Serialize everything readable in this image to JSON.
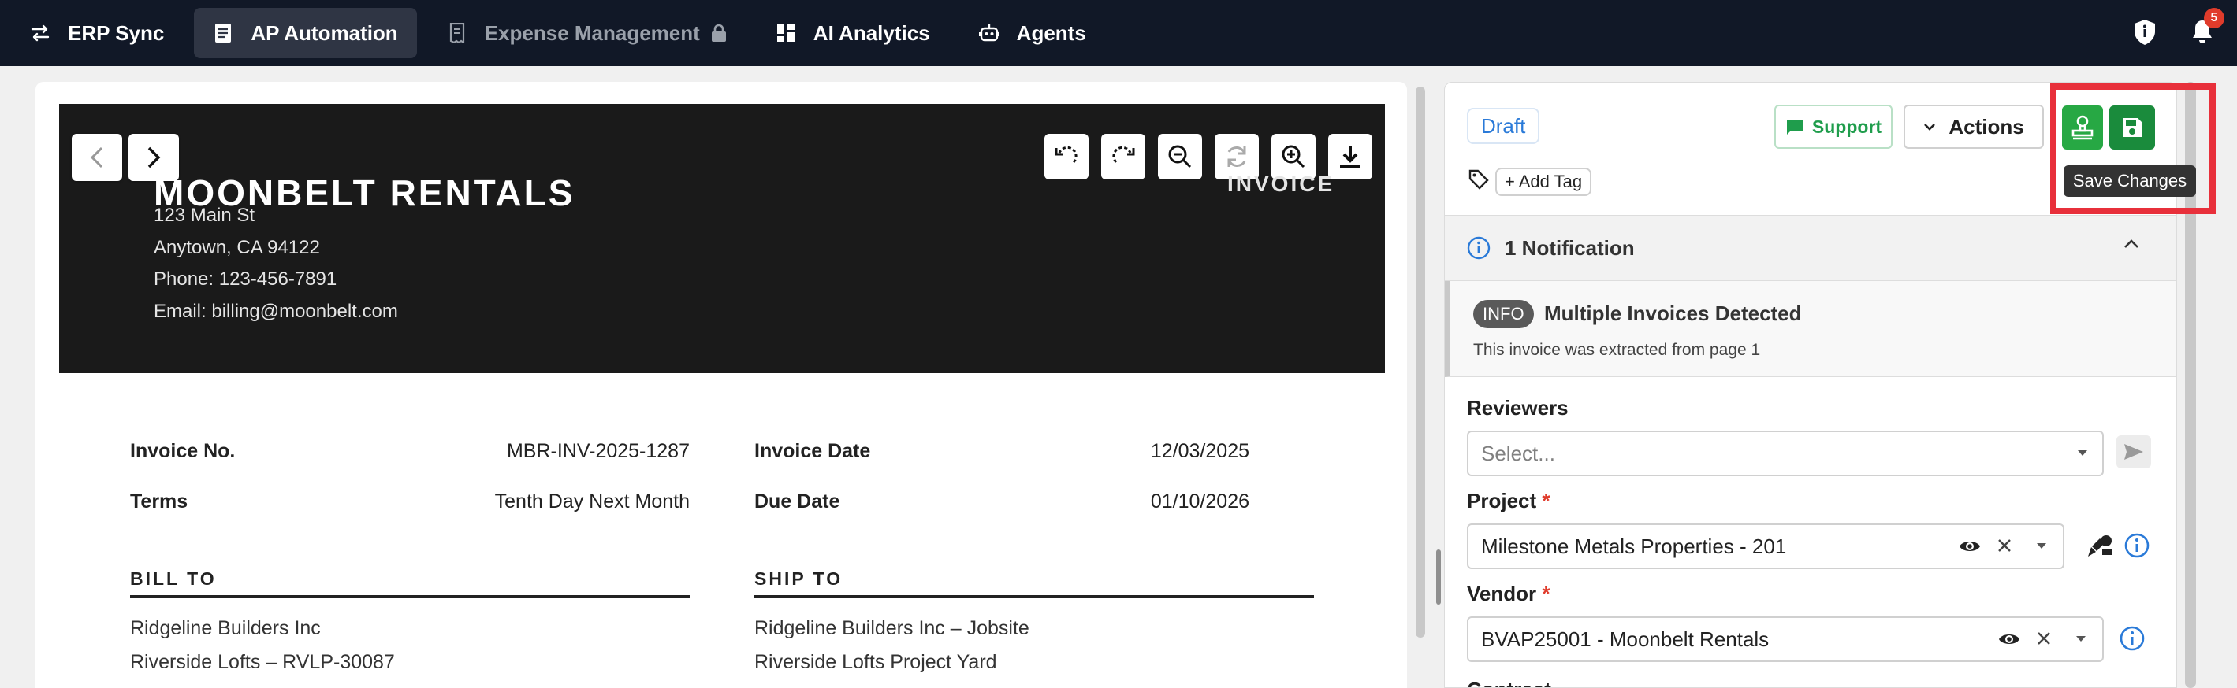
{
  "nav": {
    "items": [
      {
        "label": "ERP Sync",
        "icon": "sync-arrows-icon"
      },
      {
        "label": "AP Automation",
        "icon": "document-icon",
        "active": true
      },
      {
        "label": "Expense Management",
        "icon": "receipt-icon",
        "locked": true
      },
      {
        "label": "AI Analytics",
        "icon": "grid-icon"
      },
      {
        "label": "Agents",
        "icon": "robot-icon"
      }
    ],
    "notification_count": "5"
  },
  "invoice": {
    "company": "MOONBELT RENTALS",
    "address1": "123 Main St",
    "address2": "Anytown, CA 94122",
    "phone": "Phone: 123-456-7891",
    "email": "Email: billing@moonbelt.com",
    "doc_title": "INVOICE",
    "invoice_no_label": "Invoice No.",
    "invoice_no": "MBR-INV-2025-1287",
    "terms_label": "Terms",
    "terms": "Tenth Day Next Month",
    "invoice_date_label": "Invoice Date",
    "invoice_date": "12/03/2025",
    "due_date_label": "Due Date",
    "due_date": "01/10/2026",
    "bill_to_title": "BILL TO",
    "bill_to": [
      "Ridgeline Builders Inc",
      "Riverside Lofts – RVLP-30087"
    ],
    "ship_to_title": "SHIP TO",
    "ship_to": [
      "Ridgeline Builders Inc – Jobsite",
      "Riverside Lofts Project Yard"
    ]
  },
  "panel": {
    "status": "Draft",
    "support_label": "Support",
    "actions_label": "Actions",
    "add_tag_label": "+ Add Tag",
    "save_tooltip": "Save Changes",
    "notification_header": "1 Notification",
    "notification": {
      "badge": "INFO",
      "title": "Multiple Invoices Detected",
      "text": "This invoice was extracted from page 1"
    },
    "reviewers_label": "Reviewers",
    "reviewers_placeholder": "Select...",
    "project_label": "Project",
    "project_value": "Milestone Metals Properties - 201",
    "vendor_label": "Vendor",
    "vendor_value": "BVAP25001 - Moonbelt Rentals",
    "contract_label": "Contract",
    "required_mark": "*"
  }
}
